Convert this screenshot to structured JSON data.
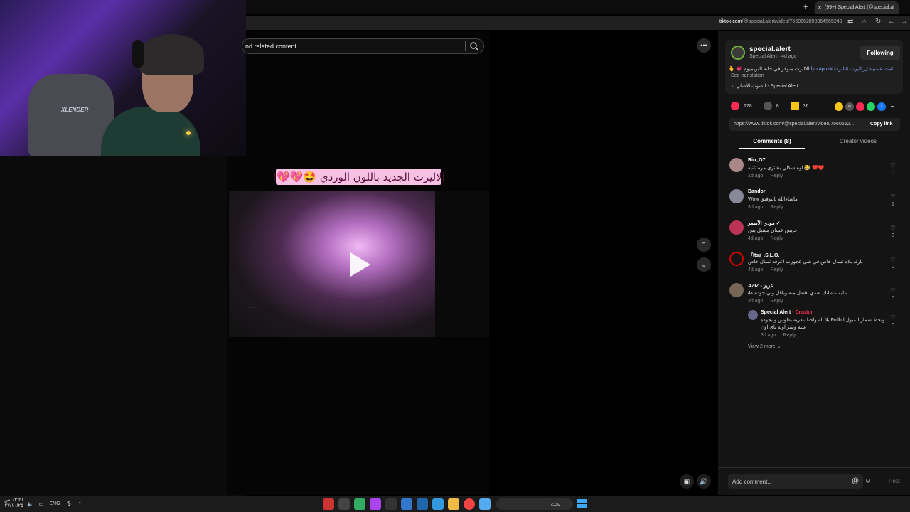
{
  "browser": {
    "tab_title": "(99+) Special Alert (@special.al",
    "new_tab": "+",
    "url_domain": "tiktok.com",
    "url_path": "/@special.alert/video/7560662898964565249"
  },
  "webcam": {
    "chair_label": "XLENDER"
  },
  "search": {
    "placeholder": "nd related content"
  },
  "video": {
    "caption": "الاليرت الجديد باللون الوردي 🤩💖💖!",
    "play_icon": "play-icon"
  },
  "creator": {
    "username": "special.alert",
    "display_line": "Special Alert · 4d ago",
    "follow_label": "Following",
    "description_text": "الاليرت متوفر في خانة البريميوم 💗 🫰",
    "description_tags": "#بث #سبيشل_اليرت #اليرت #fyp #pov",
    "see_translation": "See translation",
    "sound": "الصوت الأصلي - Special Alert"
  },
  "stats": {
    "likes": "178",
    "comments": "8",
    "saves": "36"
  },
  "share": {
    "colors": [
      "#f5c518",
      "#555555",
      "#fe2c55",
      "#25d366",
      "#1877f2"
    ],
    "link": "https://www.tiktok.com/@special.alert/video/7560662...",
    "copy_label": "Copy link"
  },
  "tabs": {
    "comments": "Comments (8)",
    "creator_videos": "Creator videos"
  },
  "comments": [
    {
      "name": "Rio_G7",
      "text": "اوه شكلي بشتري مره ثانيه 😂 ❤️❤️",
      "age": "2d ago",
      "reply": "Reply",
      "likes": "0",
      "color": "#a88"
    },
    {
      "name": "Bandor",
      "text": "Wow ماشاءالله بالتوفيق",
      "age": "3d ago",
      "reply": "Reply",
      "likes": "1",
      "color": "#889"
    },
    {
      "name": "مودي الأسمر ✓",
      "text": "خايس عشان مشبل بس",
      "age": "4d ago",
      "reply": "Reply",
      "likes": "0",
      "color": "#b35"
    },
    {
      "name": "『Its』.S.L.O.",
      "text": "يارلد بلاه تسال خاص في شي عجوزت اعرفه تسال خاص",
      "age": "4d ago",
      "reply": "Reply",
      "likes": "0",
      "color": "#c00"
    },
    {
      "name": "AZIZ - عزيز",
      "text": "4k عليه عشانك عندي افضل منه وباقل وبي جوده",
      "age": "3d ago",
      "reply": "Reply",
      "likes": "0",
      "color": "#765"
    },
    {
      "name": "Special Alert",
      "creator_tag": "· Creator",
      "text": "بلا اله واحنا بنغريه بطوس و بجوده Fullhd ويحط شمار الميول",
      "text2": "عليه ويثير اوته باي اون",
      "age": "3d ago",
      "reply": "Reply",
      "likes": "0",
      "color": "#668"
    }
  ],
  "view_more": "View 2 more ⌄",
  "comment_input": {
    "placeholder": "Add comment...",
    "post": "Post"
  },
  "taskbar": {
    "time": "٠٣:٢١ ص",
    "date": "٢٧/١٠/٢٥",
    "lang": "ENG",
    "search_placeholder": "بحث"
  }
}
